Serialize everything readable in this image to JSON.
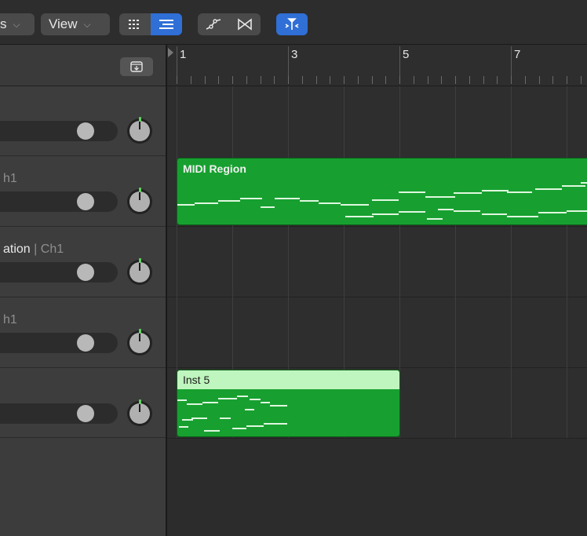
{
  "toolbar": {
    "edit_menu_fragment": "s",
    "view_label": "View",
    "accent_color": "#2f6fd6"
  },
  "ruler": {
    "bar_numbers": [
      "1",
      "3",
      "5",
      "7"
    ]
  },
  "tracks": [
    {
      "name": "",
      "channel": ""
    },
    {
      "name": "h1",
      "channel": ""
    },
    {
      "name": "ation",
      "channel": "| Ch1"
    },
    {
      "name": "h1",
      "channel": ""
    },
    {
      "name": "",
      "channel": ""
    }
  ],
  "regions": [
    {
      "title": "MIDI Region",
      "color": "#17a030"
    },
    {
      "title": "Inst 5",
      "color": "#17a030",
      "header_color": "#bff5be"
    }
  ]
}
